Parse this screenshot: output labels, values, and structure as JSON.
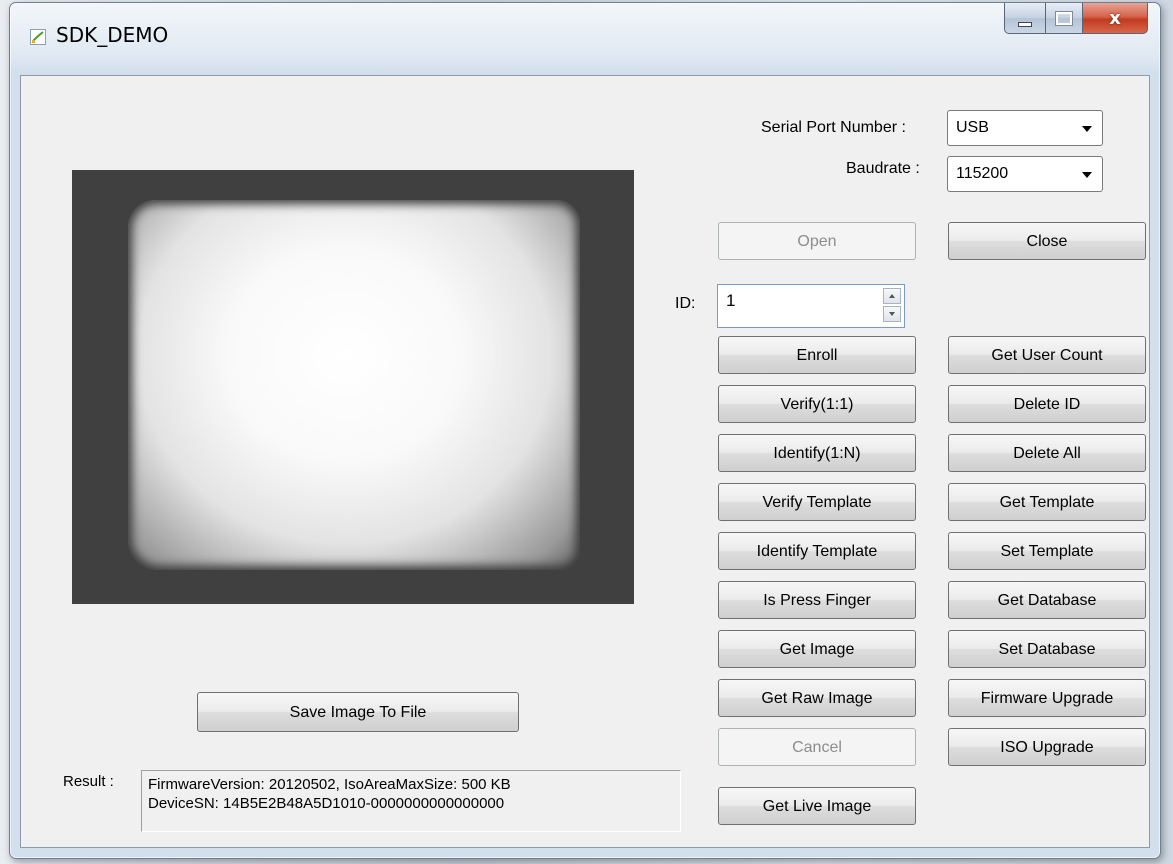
{
  "window": {
    "title": "SDK_DEMO",
    "close_glyph": "x"
  },
  "settings": {
    "serial_port_label": "Serial Port Number :",
    "serial_port_value": "USB",
    "baudrate_label": "Baudrate :",
    "baudrate_value": "115200"
  },
  "connection": {
    "open_label": "Open",
    "close_label": "Close"
  },
  "id_field": {
    "label": "ID:",
    "value": "1"
  },
  "left_buttons": [
    "Enroll",
    "Verify(1:1)",
    "Identify(1:N)",
    "Verify Template",
    "Identify Template",
    "Is Press Finger",
    "Get Image",
    "Get Raw Image",
    "Cancel",
    "Get Live Image"
  ],
  "right_buttons": [
    "Get User Count",
    "Delete ID",
    "Delete All",
    "Get Template",
    "Set Template",
    "Get Database",
    "Set Database",
    "Firmware Upgrade",
    "ISO Upgrade"
  ],
  "save_image_label": "Save Image To File",
  "result": {
    "label": "Result :",
    "line1": "FirmwareVersion: 20120502, IsoAreaMaxSize: 500 KB",
    "line2": "DeviceSN: 14B5E2B48A5D1010-0000000000000000"
  },
  "icons": {
    "app": "app-icon",
    "minimize": "minimize-icon",
    "maximize": "maximize-icon",
    "close": "close-icon"
  },
  "colors": {
    "image_frame": "#404040",
    "close_button": "#c94a32",
    "disabled_text": "#8d8d8d"
  }
}
